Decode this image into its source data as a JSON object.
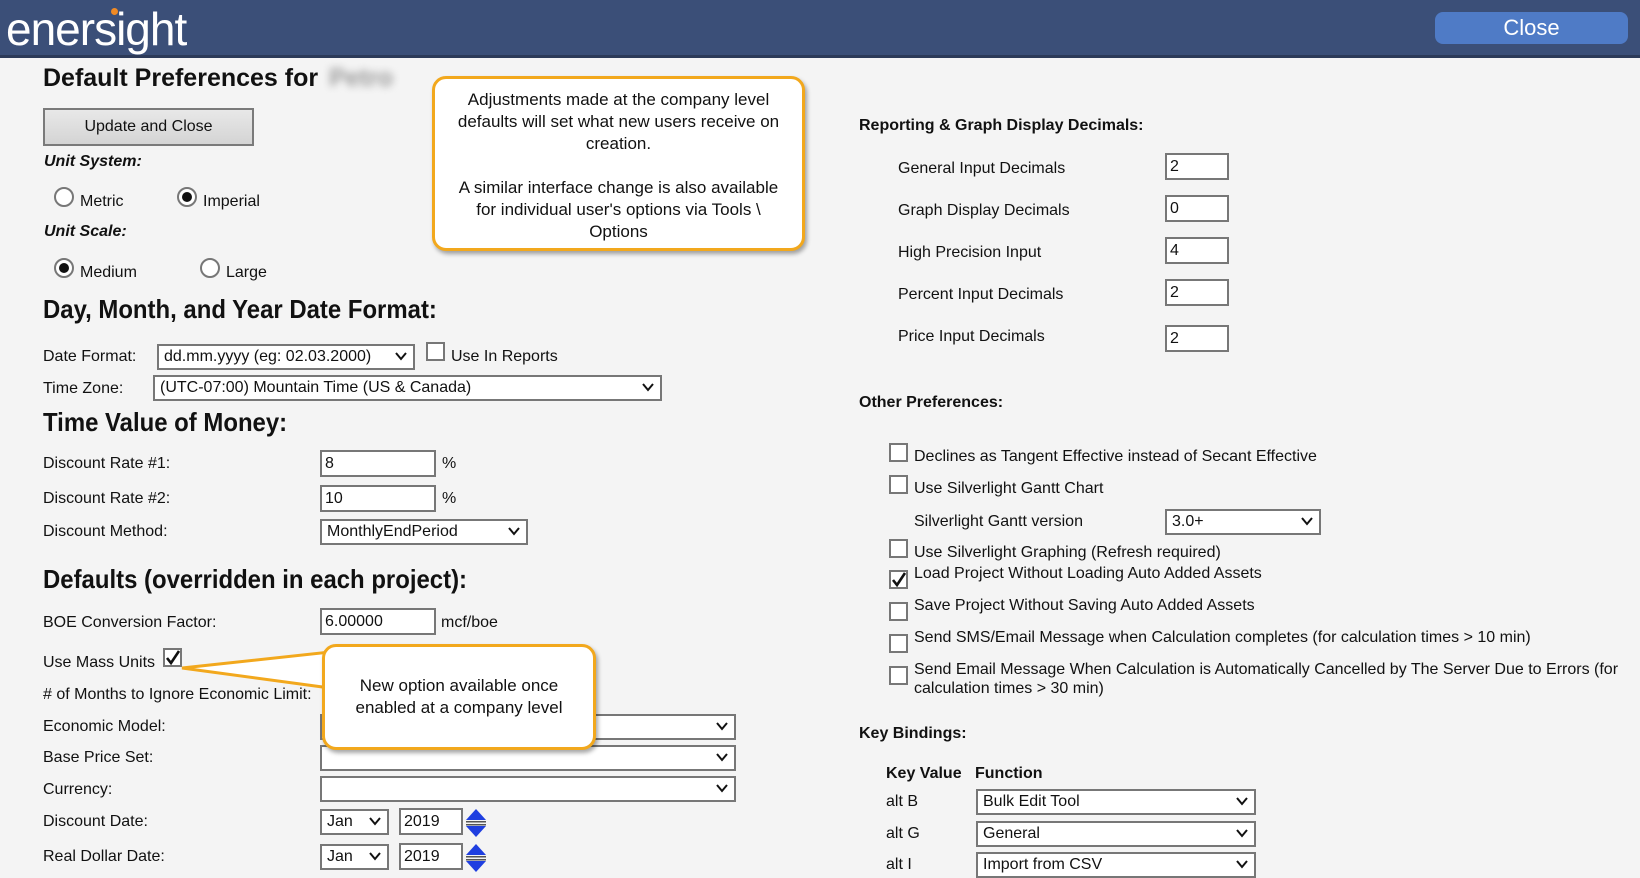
{
  "app": {
    "logo": "enersight",
    "close_label": "Close"
  },
  "page": {
    "title": "Default Preferences for",
    "company_name_blurred": "Petro",
    "update_button": "Update and Close"
  },
  "unit_system": {
    "label": "Unit System:",
    "options": [
      {
        "label": "Metric",
        "selected": false
      },
      {
        "label": "Imperial",
        "selected": true
      }
    ]
  },
  "unit_scale": {
    "label": "Unit Scale:",
    "options": [
      {
        "label": "Medium",
        "selected": true
      },
      {
        "label": "Large",
        "selected": false
      }
    ]
  },
  "date_format": {
    "heading": "Day, Month, and Year Date Format:",
    "date_format_label": "Date Format:",
    "date_format_value": "dd.mm.yyyy (eg: 02.03.2000)",
    "use_in_reports_label": "Use In Reports",
    "use_in_reports_checked": false,
    "time_zone_label": "Time Zone:",
    "time_zone_value": "(UTC-07:00) Mountain Time (US & Canada)"
  },
  "tvm": {
    "heading": "Time Value of Money:",
    "rate1_label": "Discount Rate #1:",
    "rate1_value": "8",
    "rate2_label": "Discount Rate #2:",
    "rate2_value": "10",
    "percent": "%",
    "method_label": "Discount Method:",
    "method_value": "MonthlyEndPeriod"
  },
  "defaults": {
    "heading": "Defaults (overridden in each project):",
    "boe_label": "BOE Conversion Factor:",
    "boe_value": "6.00000",
    "boe_unit": "mcf/boe",
    "mass_units_label": "Use Mass Units",
    "mass_units_checked": true,
    "months_ignore_label": "# of Months to Ignore Economic Limit:",
    "economic_model_label": "Economic Model:",
    "economic_model_value": "",
    "base_price_label": "Base Price Set:",
    "base_price_value": "",
    "currency_label": "Currency:",
    "currency_value": "",
    "discount_date_label": "Discount Date:",
    "discount_date_month": "Jan",
    "discount_date_year": "2019",
    "real_dollar_label": "Real Dollar Date:",
    "real_dollar_month": "Jan",
    "real_dollar_year": "2019"
  },
  "callouts": {
    "top_line1": "Adjustments made at the company level defaults will set what new users receive on creation.",
    "top_line2": "A similar interface change is also available for individual user's options via Tools \\ Options",
    "mass": "New option available once enabled at a company level"
  },
  "decimals": {
    "heading": "Reporting & Graph Display Decimals:",
    "items": [
      {
        "label": "General Input Decimals",
        "value": "2"
      },
      {
        "label": "Graph Display Decimals",
        "value": "0"
      },
      {
        "label": "High Precision Input",
        "value": "4"
      },
      {
        "label": "Percent Input Decimals",
        "value": "2"
      },
      {
        "label": "Price Input Decimals",
        "value": "2"
      }
    ]
  },
  "other": {
    "heading": "Other Preferences:",
    "items": [
      {
        "label": "Declines as Tangent Effective instead of Secant Effective",
        "checked": false
      },
      {
        "label": "Use Silverlight Gantt Chart",
        "checked": false
      },
      {
        "label": "Use Silverlight Graphing (Refresh required)",
        "checked": false
      },
      {
        "label": "Load Project Without Loading Auto Added Assets",
        "checked": true
      },
      {
        "label": "Save Project Without Saving Auto Added Assets",
        "checked": false
      },
      {
        "label": "Send SMS/Email Message when Calculation completes (for calculation times > 10 min)",
        "checked": false
      },
      {
        "label": "Send Email Message When Calculation is Automatically Cancelled by The Server Due to Errors (for",
        "label_line2": "calculation times > 30 min)",
        "checked": false
      }
    ],
    "gantt_version_label": "Silverlight Gantt version",
    "gantt_version_value": "3.0+"
  },
  "key_bindings": {
    "heading": "Key Bindings:",
    "col_key": "Key Value",
    "col_function": "Function",
    "rows": [
      {
        "key": "alt B",
        "function": "Bulk Edit Tool"
      },
      {
        "key": "alt G",
        "function": "General"
      },
      {
        "key": "alt I",
        "function": "Import from CSV"
      }
    ]
  }
}
